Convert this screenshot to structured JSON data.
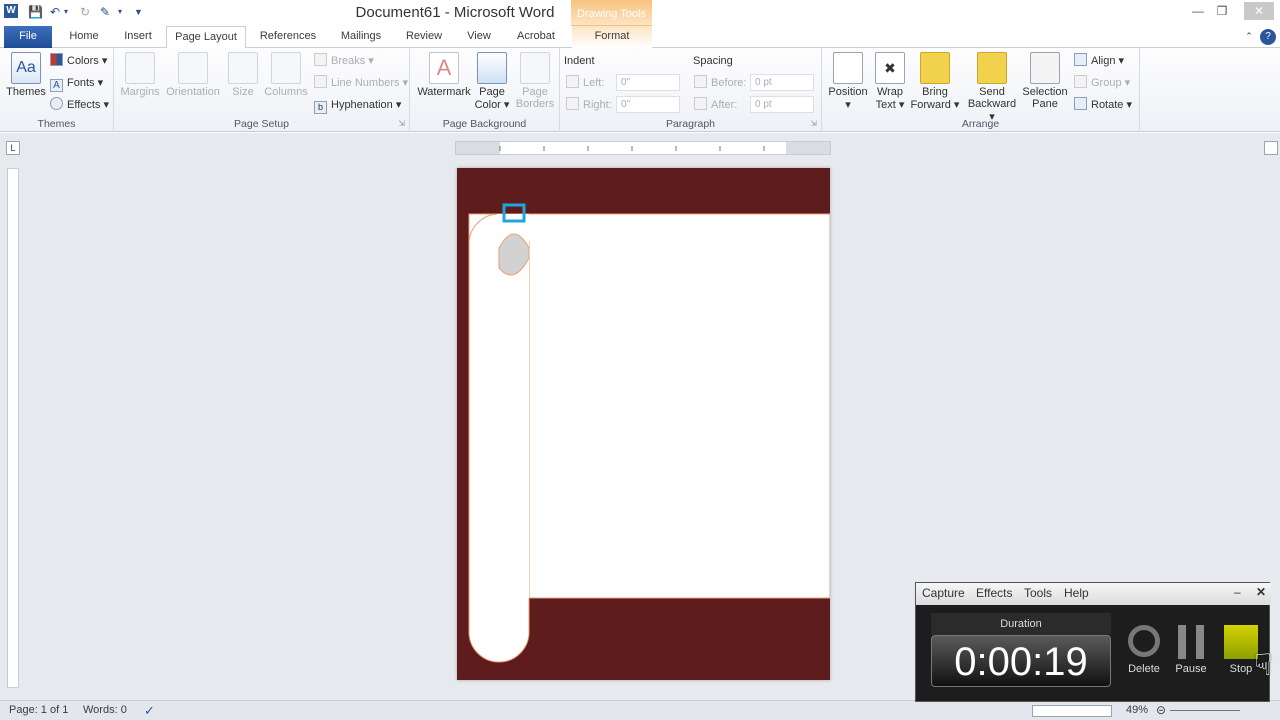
{
  "window": {
    "title": "Document61  -  Microsoft Word",
    "context_tab_group": "Drawing Tools"
  },
  "tabs": [
    "File",
    "Home",
    "Insert",
    "Page Layout",
    "References",
    "Mailings",
    "Review",
    "View",
    "Acrobat",
    "Format"
  ],
  "ribbon": {
    "themes": {
      "themes_label": "Themes",
      "colors": "Colors",
      "fonts": "Fonts",
      "effects": "Effects",
      "group": "Themes"
    },
    "page_setup": {
      "margins": "Margins",
      "orientation": "Orientation",
      "size": "Size",
      "columns": "Columns",
      "breaks": "Breaks",
      "line_numbers": "Line Numbers",
      "hyphenation": "Hyphenation",
      "group": "Page Setup"
    },
    "page_background": {
      "watermark": "Watermark",
      "page_color_1": "Page",
      "page_color_2": "Color",
      "page_borders_1": "Page",
      "page_borders_2": "Borders",
      "group": "Page Background"
    },
    "paragraph": {
      "indent": "Indent",
      "left_label": "Left:",
      "left_value": "0\"",
      "right_label": "Right:",
      "right_value": "0\"",
      "spacing": "Spacing",
      "before_label": "Before:",
      "before_value": "0 pt",
      "after_label": "After:",
      "after_value": "0 pt",
      "group": "Paragraph"
    },
    "arrange": {
      "position": "Position",
      "wrap_1": "Wrap",
      "wrap_2": "Text",
      "bring_1": "Bring",
      "bring_2": "Forward",
      "send_1": "Send",
      "send_2": "Backward",
      "sel_1": "Selection",
      "sel_2": "Pane",
      "align": "Align",
      "group_btn": "Group",
      "rotate": "Rotate",
      "group": "Arrange"
    }
  },
  "colors": {
    "page_band": "#5e1d1c",
    "accent_outline": "#e8a070",
    "selection": "#1fa6e0",
    "ribbon_blue": "#2b579a"
  },
  "statusbar": {
    "page": "Page: 1 of 1",
    "words": "Words: 0",
    "zoom": "49%"
  },
  "recorder": {
    "menu": [
      "Capture",
      "Effects",
      "Tools",
      "Help"
    ],
    "duration_label": "Duration",
    "time": "0:00:19",
    "delete": "Delete",
    "pause": "Pause",
    "stop": "Stop"
  }
}
